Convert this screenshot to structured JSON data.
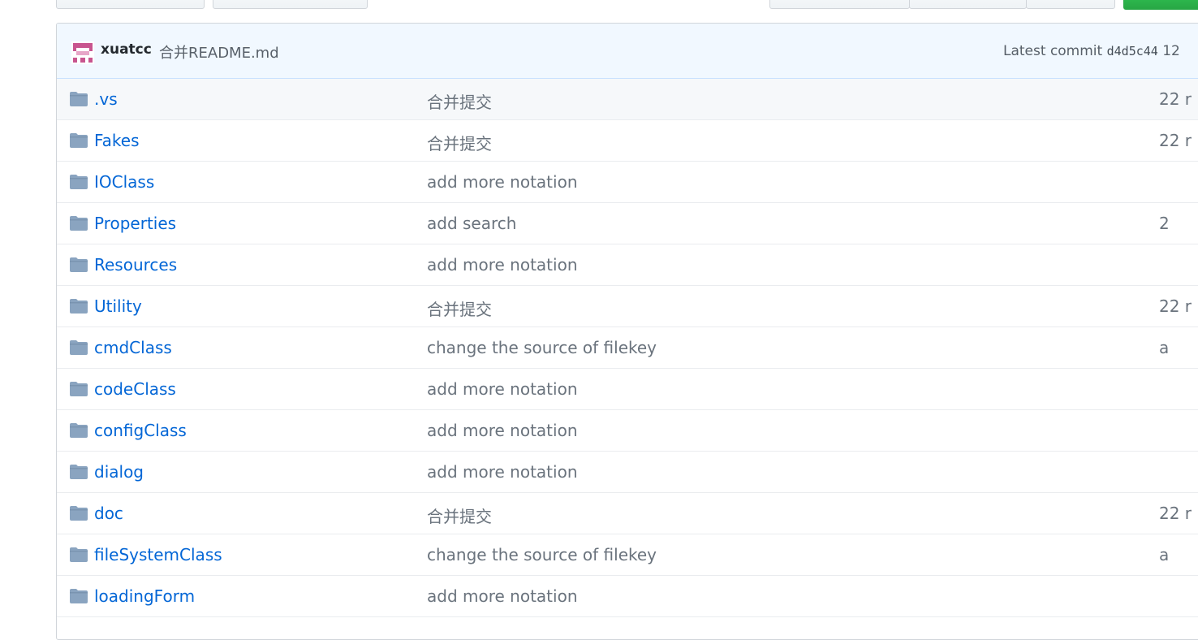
{
  "colors": {
    "link": "#0366d6",
    "muted": "#6a737d",
    "commit_bg": "#f1f8ff",
    "green_button": "#28a745",
    "folder": "#79b8ff"
  },
  "commit": {
    "author": "xuatcc",
    "message": "合并README.md",
    "latest_label": "Latest commit",
    "sha": "d4d5c44",
    "time": "12"
  },
  "files": [
    {
      "icon": "folder-icon",
      "name": ".vs",
      "message": "合并提交",
      "age": "22 r"
    },
    {
      "icon": "folder-icon",
      "name": "Fakes",
      "message": "合并提交",
      "age": "22 r"
    },
    {
      "icon": "folder-icon",
      "name": "IOClass",
      "message": "add more notation",
      "age": ""
    },
    {
      "icon": "folder-icon",
      "name": "Properties",
      "message": "add search",
      "age": "2"
    },
    {
      "icon": "folder-icon",
      "name": "Resources",
      "message": "add more notation",
      "age": ""
    },
    {
      "icon": "folder-icon",
      "name": "Utility",
      "message": "合并提交",
      "age": "22 r"
    },
    {
      "icon": "folder-icon",
      "name": "cmdClass",
      "message": "change the source of filekey",
      "age": "a"
    },
    {
      "icon": "folder-icon",
      "name": "codeClass",
      "message": "add more notation",
      "age": ""
    },
    {
      "icon": "folder-icon",
      "name": "configClass",
      "message": "add more notation",
      "age": ""
    },
    {
      "icon": "folder-icon",
      "name": "dialog",
      "message": "add more notation",
      "age": ""
    },
    {
      "icon": "folder-icon",
      "name": "doc",
      "message": "合并提交",
      "age": "22 r"
    },
    {
      "icon": "folder-icon",
      "name": "fileSystemClass",
      "message": "change the source of filekey",
      "age": "a"
    },
    {
      "icon": "folder-icon",
      "name": "loadingForm",
      "message": "add more notation",
      "age": ""
    }
  ]
}
